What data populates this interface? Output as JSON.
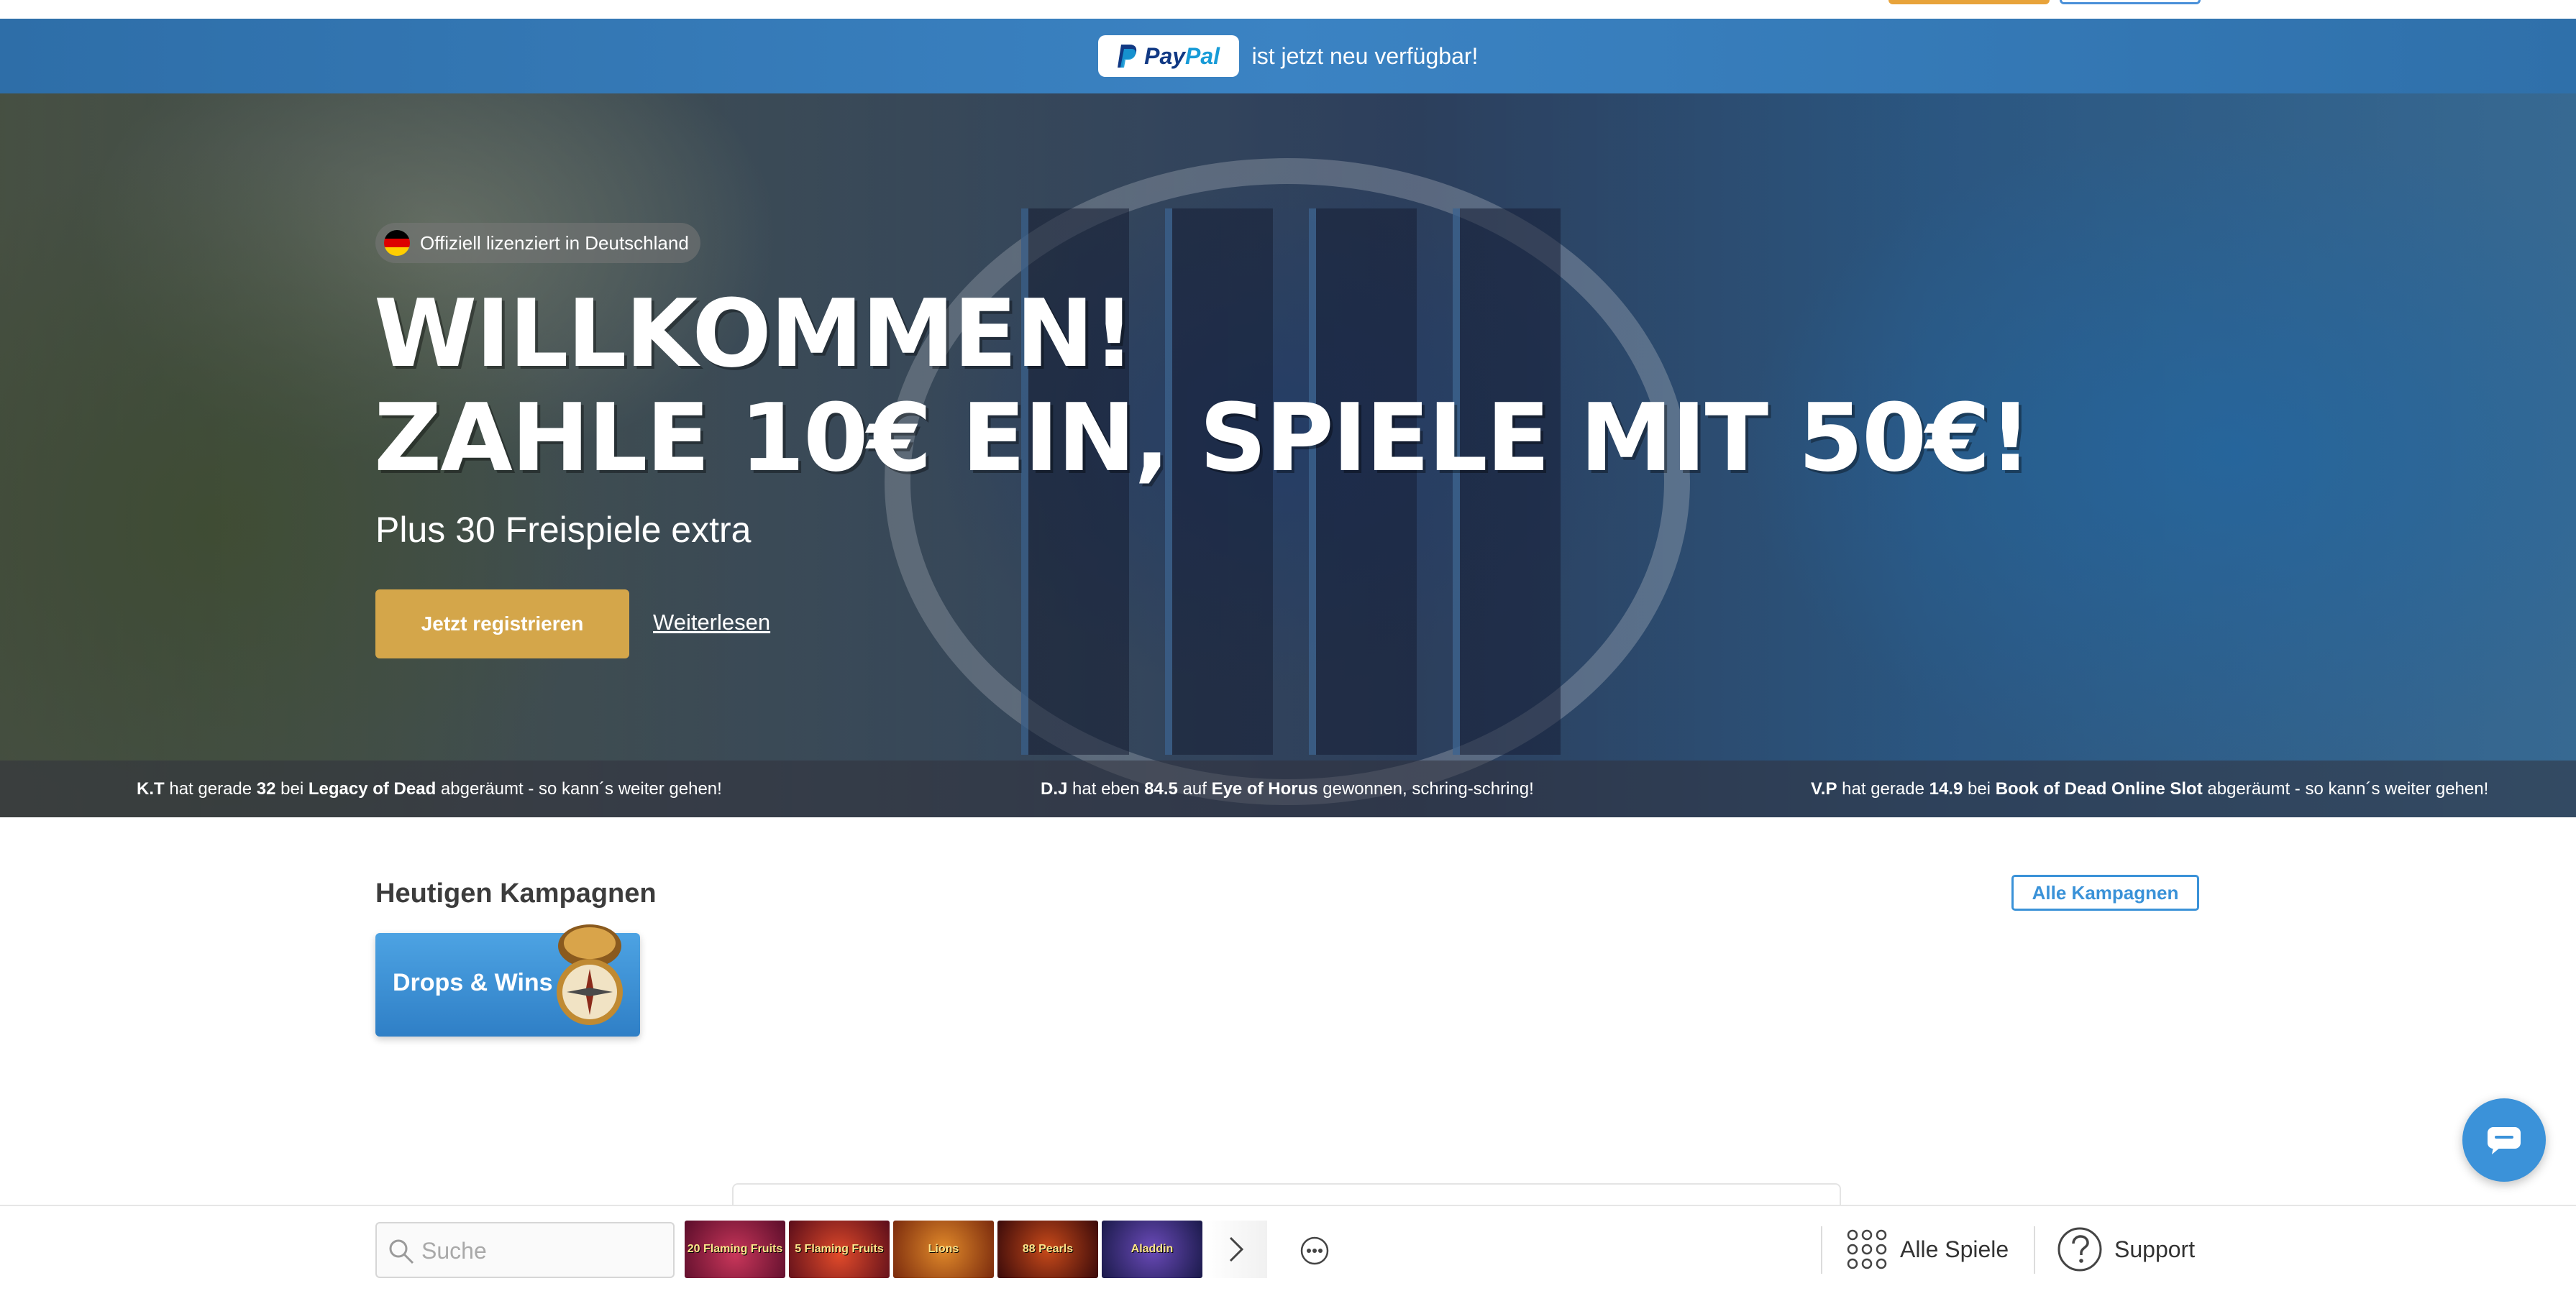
{
  "paypal_bar": {
    "logo_pay": "Pay",
    "logo_pal": "Pal",
    "message": "ist jetzt neu verfügbar!"
  },
  "hero": {
    "license": "Offiziell lizenziert in Deutschland",
    "title_line1": "Willkommen!",
    "title_line2": "Zahle 10€ ein, spiele mit 50€!",
    "subtitle": "Plus 30 Freispiele extra",
    "register_label": "Jetzt registrieren",
    "readmore_label": "Weiterlesen"
  },
  "ticker": [
    {
      "user": "K.T",
      "verb": "hat gerade",
      "amount": "32",
      "prep": "bei",
      "game": "Legacy of Dead",
      "tail": "abgeräumt - so kann´s weiter gehen!"
    },
    {
      "user": "D.J",
      "verb": "hat eben",
      "amount": "84.5",
      "prep": "auf",
      "game": "Eye of Horus",
      "tail": "gewonnen, schring-schring!"
    },
    {
      "user": "V.P",
      "verb": "hat gerade",
      "amount": "14.9",
      "prep": "bei",
      "game": "Book of Dead Online Slot",
      "tail": "abgeräumt - so kann´s weiter gehen!"
    }
  ],
  "campaigns": {
    "title": "Heutigen Kampagnen",
    "all_label": "Alle Kampagnen",
    "card_label": "Drops & Wins"
  },
  "bottom_bar": {
    "search_placeholder": "Suche",
    "games": [
      {
        "name": "20 Flaming Fruits",
        "icon": "game-thumb-20-flaming-fruits"
      },
      {
        "name": "5 Flaming Fruits",
        "icon": "game-thumb-5-flaming-fruits"
      },
      {
        "name": "Lions",
        "icon": "game-thumb-lions"
      },
      {
        "name": "88 Pearls",
        "icon": "game-thumb-88-pearls"
      },
      {
        "name": "Aladdin",
        "icon": "game-thumb-aladdin"
      }
    ],
    "all_games_label": "Alle Spiele",
    "support_label": "Support"
  },
  "colors": {
    "paypal_bar": "#3b83c3",
    "register_button": "#d4a64a",
    "accent_blue": "#3a92d8",
    "top_button_orange": "#e8a33a"
  }
}
